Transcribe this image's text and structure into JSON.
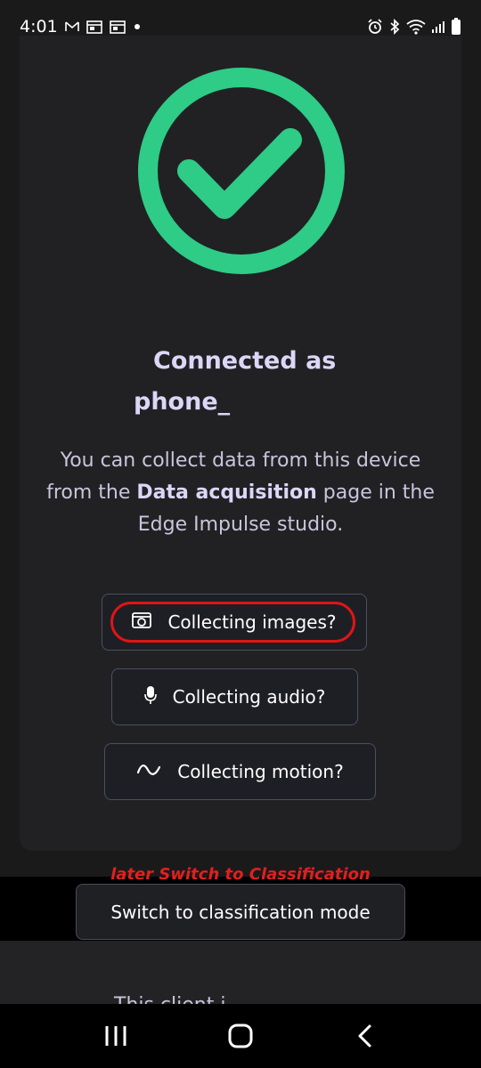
{
  "status_bar": {
    "time": "4:01",
    "left_icons": [
      "gmail-icon",
      "calendar-icon",
      "calendar-icon",
      "dot-icon"
    ],
    "right_icons": [
      "alarm-icon",
      "bluetooth-icon",
      "wifi-icon",
      "signal-icon",
      "battery-icon"
    ]
  },
  "card": {
    "check_color": "#2ecc86",
    "connected_line1": "Connected as",
    "connected_line2": "phone_",
    "info": {
      "text_before": "You can collect data from this device from the ",
      "bold": "Data acquisition",
      "text_after": " page in the Edge Impulse studio."
    },
    "buttons": {
      "images": "Collecting images?",
      "audio": "Collecting audio?",
      "motion": "Collecting motion?"
    }
  },
  "annotation": "later Switch to Classification",
  "switch_button": "Switch to classification mode",
  "under_text": "This client i",
  "colors": {
    "accent_green": "#2ecc86",
    "highlight_red": "#e01515",
    "background": "#1a1a1b"
  }
}
